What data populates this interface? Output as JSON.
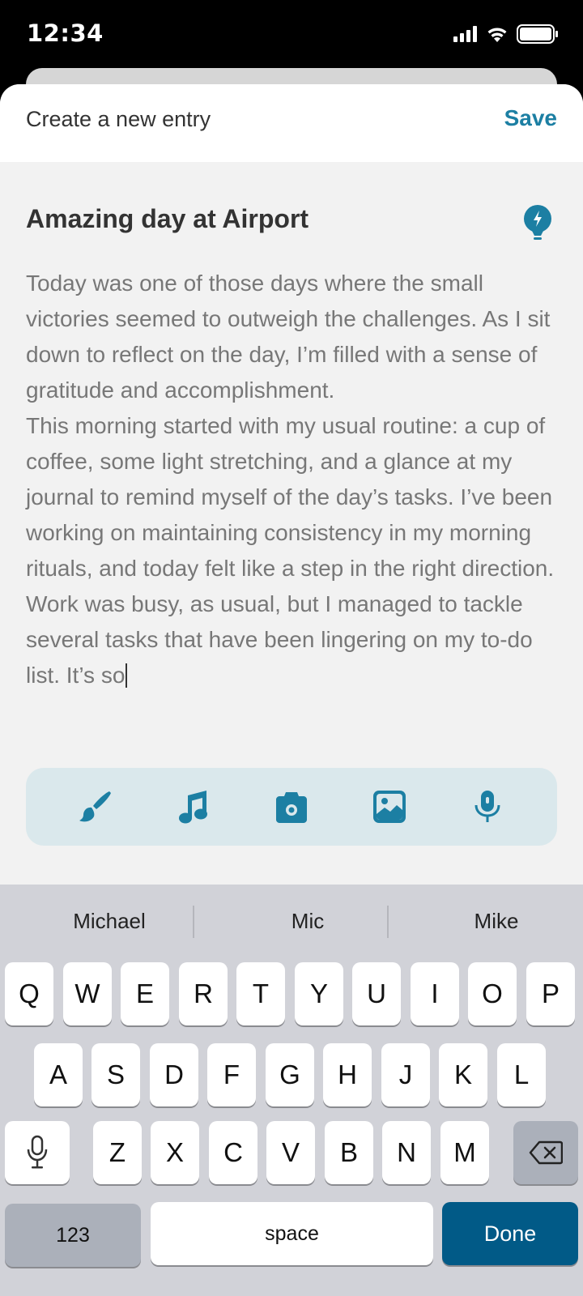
{
  "status_bar": {
    "time": "12:34"
  },
  "header": {
    "title": "Create a new entry",
    "save_label": "Save"
  },
  "entry": {
    "title": "Amazing day at Airport",
    "paragraphs": [
      "Today was one of those days where the small victories seemed to outweigh the challenges. As I sit down to reflect on the day, I’m filled with a sense of gratitude and accomplishment.",
      "This morning started with my usual routine: a cup of coffee, some light stretching, and a glance at my journal to remind myself of the day’s tasks. I’ve been working on maintaining consistency in my morning rituals, and today felt like a step in the right direction.",
      "Work was busy, as usual, but I managed to tackle several tasks that have been lingering on my to-do list. It’s so"
    ]
  },
  "toolbar": {
    "tools": [
      {
        "icon": "brush-icon"
      },
      {
        "icon": "music-note-icon"
      },
      {
        "icon": "camera-icon"
      },
      {
        "icon": "image-icon"
      },
      {
        "icon": "microphone-icon"
      }
    ]
  },
  "keyboard": {
    "suggestions": [
      "Michael",
      "Mic",
      "Mike"
    ],
    "row1": [
      "Q",
      "W",
      "E",
      "R",
      "T",
      "Y",
      "U",
      "I",
      "O",
      "P"
    ],
    "row2": [
      "A",
      "S",
      "D",
      "F",
      "G",
      "H",
      "J",
      "K",
      "L"
    ],
    "row3": [
      "Z",
      "X",
      "C",
      "V",
      "B",
      "N",
      "M"
    ],
    "numbers_label": "123",
    "space_label": "space",
    "done_label": "Done"
  },
  "colors": {
    "accent": "#1c7fa3",
    "done_key": "#015a87",
    "toolbar_bg": "#dae8ec"
  }
}
